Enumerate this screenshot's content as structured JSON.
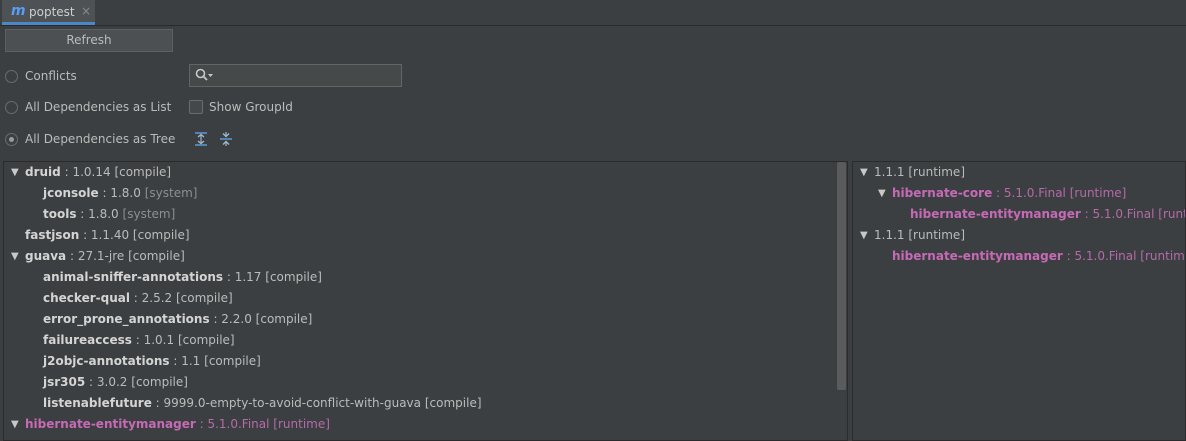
{
  "tab": {
    "icon": "m",
    "label": "poptest",
    "close": "×"
  },
  "toolbar": {
    "refresh_label": "Refresh"
  },
  "options": {
    "conflicts": "Conflicts",
    "list": "All Dependencies as List",
    "tree": "All Dependencies as Tree",
    "show_group_id": "Show GroupId",
    "selected": "tree"
  },
  "search": {
    "value": "",
    "placeholder": ""
  },
  "icons": {
    "search": "search-icon",
    "expand_all": "expand-all-icon",
    "collapse_all": "collapse-all-icon",
    "tree_expanded": "triangle-down-icon"
  },
  "colors": {
    "conflict": "#c66ab5",
    "accent": "#4a88c7"
  },
  "tree": [
    {
      "name": "druid",
      "version": "1.0.14",
      "scope": "[compile]",
      "expanded": true,
      "depth": 0,
      "conflict": false
    },
    {
      "name": "jconsole",
      "version": "1.8.0",
      "scope": "[system]",
      "depth": 1,
      "conflict": false,
      "dim_scope": true
    },
    {
      "name": "tools",
      "version": "1.8.0",
      "scope": "[system]",
      "depth": 1,
      "conflict": false,
      "dim_scope": true
    },
    {
      "name": "fastjson",
      "version": "1.1.40",
      "scope": "[compile]",
      "depth": 0,
      "conflict": false
    },
    {
      "name": "guava",
      "version": "27.1-jre",
      "scope": "[compile]",
      "expanded": true,
      "depth": 0,
      "conflict": false
    },
    {
      "name": "animal-sniffer-annotations",
      "version": "1.17",
      "scope": "[compile]",
      "depth": 1,
      "conflict": false
    },
    {
      "name": "checker-qual",
      "version": "2.5.2",
      "scope": "[compile]",
      "depth": 1,
      "conflict": false
    },
    {
      "name": "error_prone_annotations",
      "version": "2.2.0",
      "scope": "[compile]",
      "depth": 1,
      "conflict": false
    },
    {
      "name": "failureaccess",
      "version": "1.0.1",
      "scope": "[compile]",
      "depth": 1,
      "conflict": false
    },
    {
      "name": "j2objc-annotations",
      "version": "1.1",
      "scope": "[compile]",
      "depth": 1,
      "conflict": false
    },
    {
      "name": "jsr305",
      "version": "3.0.2",
      "scope": "[compile]",
      "depth": 1,
      "conflict": false
    },
    {
      "name": "listenablefuture",
      "version": "9999.0-empty-to-avoid-conflict-with-guava",
      "scope": "[compile]",
      "depth": 1,
      "conflict": false
    },
    {
      "name": "hibernate-entitymanager",
      "version": "5.1.0.Final",
      "scope": "[runtime]",
      "expanded": true,
      "depth": 0,
      "conflict": true
    }
  ],
  "usages": [
    {
      "name": "",
      "version": "1.1.1",
      "scope": "[runtime]",
      "expanded": true,
      "depth": 0,
      "conflict": false
    },
    {
      "name": "hibernate-core",
      "version": "5.1.0.Final",
      "scope": "[runtime]",
      "expanded": true,
      "depth": 1,
      "conflict": true
    },
    {
      "name": "hibernate-entitymanager",
      "version": "5.1.0.Final",
      "scope": "[runtime]",
      "depth": 2,
      "conflict": true
    },
    {
      "name": "",
      "version": "1.1.1",
      "scope": "[runtime]",
      "expanded": true,
      "depth": 0,
      "conflict": false
    },
    {
      "name": "hibernate-entitymanager",
      "version": "5.1.0.Final",
      "scope": "[runtime]",
      "depth": 1,
      "conflict": true
    }
  ]
}
